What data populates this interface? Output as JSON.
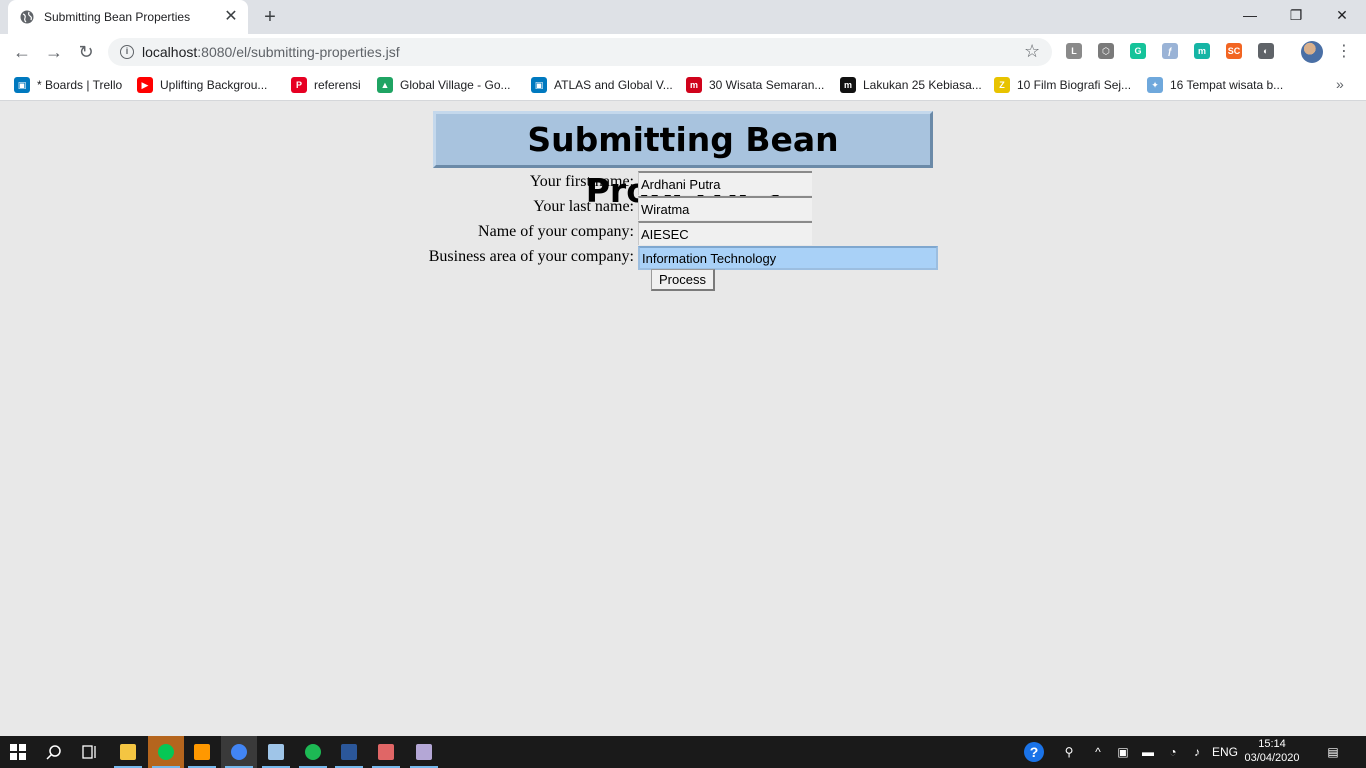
{
  "browser": {
    "tab_title": "Submitting Bean Properties",
    "tab_close": "✕",
    "new_tab": "+",
    "url_host": "localhost",
    "url_rest": ":8080/el/submitting-properties.jsf",
    "window": {
      "minimize": "—",
      "restore": "❐",
      "close": "✕"
    },
    "extensions": [
      {
        "name": "line-ext-icon",
        "glyph": "L",
        "color": "#8a8a8a"
      },
      {
        "name": "cube-ext-icon",
        "glyph": "⬡",
        "color": "#7a7a7a"
      },
      {
        "name": "grammarly-ext-icon",
        "glyph": "G",
        "color": "#15c39a"
      },
      {
        "name": "feather-ext-icon",
        "glyph": "ƒ",
        "color": "#9ab3d6"
      },
      {
        "name": "m-ext-icon",
        "glyph": "m",
        "color": "#16b5a5"
      },
      {
        "name": "sc-ext-icon",
        "glyph": "SC",
        "color": "#f26522"
      },
      {
        "name": "circle-ext-icon",
        "glyph": "◐",
        "color": "#5f6368"
      }
    ]
  },
  "bookmarks": [
    {
      "label": "* Boards | Trello",
      "icon": "trello-icon",
      "color": "#0079bf",
      "glyph": "▣"
    },
    {
      "label": "Uplifting Backgrou...",
      "icon": "youtube-icon",
      "color": "#ff0000",
      "glyph": "▶"
    },
    {
      "label": "referensi",
      "icon": "pinterest-icon",
      "color": "#e60023",
      "glyph": "P"
    },
    {
      "label": "Global Village - Go...",
      "icon": "google-drive-icon",
      "color": "#1fa463",
      "glyph": "▲"
    },
    {
      "label": "ATLAS and Global V...",
      "icon": "trello-icon",
      "color": "#0079bf",
      "glyph": "▣"
    },
    {
      "label": "30 Wisata Semaran...",
      "icon": "m-red-icon",
      "color": "#d0021b",
      "glyph": "m"
    },
    {
      "label": "Lakukan 25 Kebiasa...",
      "icon": "m-black-icon",
      "color": "#111111",
      "glyph": "m"
    },
    {
      "label": "10 Film Biografi Sej...",
      "icon": "z-icon",
      "color": "#e8c300",
      "glyph": "Z"
    },
    {
      "label": "16 Tempat wisata b...",
      "icon": "bird-icon",
      "color": "#6fa8dc",
      "glyph": "✦"
    }
  ],
  "page": {
    "title": "Submitting Bean Properties",
    "fields": [
      {
        "label": "Your first name:",
        "value": "Ardhani Putra"
      },
      {
        "label": "Your last name:",
        "value": "Wiratma"
      },
      {
        "label": "Name of your company:",
        "value": "AIESEC"
      },
      {
        "label": "Business area of your company:",
        "value": "Information Technology"
      }
    ],
    "submit_label": "Process"
  },
  "taskbar": {
    "apps": [
      {
        "name": "file-explorer-icon",
        "color": "#f4c542"
      },
      {
        "name": "line-app-icon",
        "color": "#06c755"
      },
      {
        "name": "sublime-text-icon",
        "color": "#ff9800"
      },
      {
        "name": "chrome-icon",
        "color": "#4285f4"
      },
      {
        "name": "notepad-icon",
        "color": "#9fc5e8"
      },
      {
        "name": "spotify-icon",
        "color": "#1db954"
      },
      {
        "name": "word-icon",
        "color": "#2b579a"
      },
      {
        "name": "paint-icon",
        "color": "#e06666"
      },
      {
        "name": "settings-app-icon",
        "color": "#b4a7d6"
      }
    ],
    "language": "ENG",
    "time": "15:14",
    "date": "03/04/2020"
  }
}
